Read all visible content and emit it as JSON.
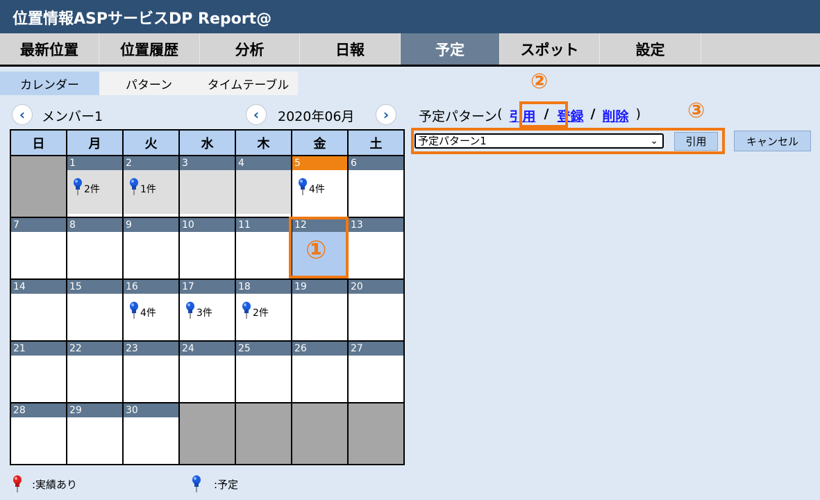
{
  "app": {
    "title": "位置情報ASPサービスDP Report@"
  },
  "nav": {
    "tabs": [
      {
        "label": "最新位置"
      },
      {
        "label": "位置履歴"
      },
      {
        "label": "分析"
      },
      {
        "label": "日報"
      },
      {
        "label": "予定",
        "active": true
      },
      {
        "label": "スポット"
      },
      {
        "label": "設定"
      }
    ]
  },
  "subnav": {
    "tabs": [
      {
        "label": "カレンダー",
        "active": true
      },
      {
        "label": "パターン"
      },
      {
        "label": "タイムテーブル"
      }
    ]
  },
  "member": {
    "prev_icon": "chevron-left-icon",
    "name": "メンバー1"
  },
  "month": {
    "prev_icon": "chevron-left-icon",
    "label": "2020年06月",
    "next_icon": "chevron-right-icon"
  },
  "calendar": {
    "weekdays": [
      "日",
      "月",
      "火",
      "水",
      "木",
      "金",
      "土"
    ],
    "weeks": [
      [
        null,
        {
          "day": "1",
          "count": "2件",
          "past": true
        },
        {
          "day": "2",
          "count": "1件",
          "past": true
        },
        {
          "day": "3",
          "past": true
        },
        {
          "day": "4",
          "past": true
        },
        {
          "day": "5",
          "count": "4件",
          "today": true
        },
        {
          "day": "6"
        }
      ],
      [
        {
          "day": "7"
        },
        {
          "day": "8"
        },
        {
          "day": "9"
        },
        {
          "day": "10"
        },
        {
          "day": "11"
        },
        {
          "day": "12",
          "selected": true
        },
        {
          "day": "13"
        }
      ],
      [
        {
          "day": "14"
        },
        {
          "day": "15"
        },
        {
          "day": "16",
          "count": "4件"
        },
        {
          "day": "17",
          "count": "3件"
        },
        {
          "day": "18",
          "count": "2件"
        },
        {
          "day": "19"
        },
        {
          "day": "20"
        }
      ],
      [
        {
          "day": "21"
        },
        {
          "day": "22"
        },
        {
          "day": "23"
        },
        {
          "day": "24"
        },
        {
          "day": "25"
        },
        {
          "day": "26"
        },
        {
          "day": "27"
        }
      ],
      [
        {
          "day": "28"
        },
        {
          "day": "29"
        },
        {
          "day": "30"
        },
        null,
        null,
        null,
        null
      ]
    ]
  },
  "pattern": {
    "label": "予定パターン",
    "open_paren": "(",
    "close_paren": ")",
    "sep": "/",
    "link_quote": "引用",
    "link_register": "登録",
    "link_delete": "削除",
    "select_value": "予定パターン1",
    "button_quote": "引用",
    "button_cancel": "キャンセル"
  },
  "callouts": {
    "one": "①",
    "two": "②",
    "three": "③"
  },
  "legend": {
    "actual": ":実績あり",
    "planned": ":予定"
  },
  "colors": {
    "titlebar": "#2e5075",
    "active_tab": "#6a7f96",
    "highlight": "#f07814",
    "today": "#f08214",
    "pin_blue": "#1a5ce0",
    "pin_red": "#e02020"
  }
}
